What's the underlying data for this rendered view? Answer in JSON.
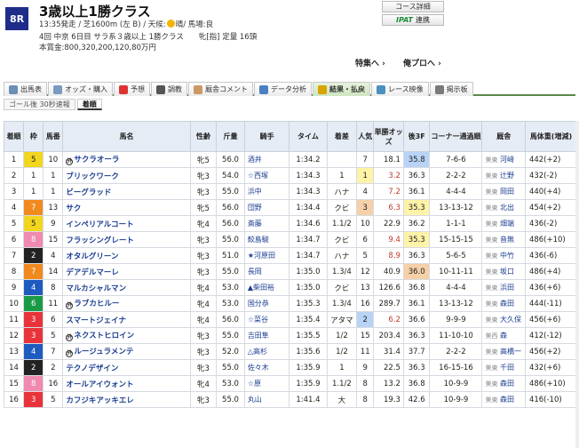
{
  "race": {
    "badge": "8R",
    "title": "3歳以上1勝クラス",
    "info1_a": "13:35発走 / 芝1600m (左 B) / 天候:",
    "weather": "晴",
    "info1_b": "/ 馬場:良",
    "info2": "4回 中京 6日目 サラ系３歳以上 1勝クラス　　牝[指] 定量 16頭",
    "info3": "本賞金:800,320,200,120,80万円"
  },
  "buttons": {
    "course": "コース詳細",
    "ipat": "IPAT",
    "ipat_sub": "連携"
  },
  "links": {
    "special": "特集へ",
    "pro": "俺プロへ"
  },
  "tabs": [
    {
      "label": "出馬表",
      "icon": "table-icon"
    },
    {
      "label": "オッズ・購入",
      "icon": "odds-icon"
    },
    {
      "label": "予想",
      "icon": "target-icon"
    },
    {
      "label": "調教",
      "icon": "timer-icon"
    },
    {
      "label": "厩舎コメント",
      "icon": "comment-icon"
    },
    {
      "label": "データ分析",
      "icon": "chart-icon"
    },
    {
      "label": "結果・払戻",
      "icon": "coin-icon"
    },
    {
      "label": "レース映像",
      "icon": "video-icon"
    },
    {
      "label": "掲示板",
      "icon": "board-icon"
    }
  ],
  "subtabs": [
    "ゴール後 30秒速報",
    "着順"
  ],
  "columns": [
    "着順",
    "枠",
    "馬番",
    "馬名",
    "性齢",
    "斤量",
    "騎手",
    "タイム",
    "着差",
    "人気",
    "単勝オッズ",
    "後3F",
    "コーナー通過順",
    "厩舎",
    "馬体重(増減)"
  ],
  "rows": [
    {
      "pos": "1",
      "gate": "5",
      "num": "10",
      "mark": "外",
      "name": "サクラオーラ",
      "sa": "牝5",
      "wgt": "56.0",
      "jockey": "酒井",
      "time": "1:34.2",
      "margin": "",
      "pop": "7",
      "odds": "18.1",
      "f3": "35.8",
      "corner": "7-6-6",
      "tr": "美東",
      "trainer": "河﨑",
      "bw": "442(+2)",
      "f3c": "m2"
    },
    {
      "pos": "2",
      "gate": "1",
      "num": "1",
      "mark": "",
      "name": "ブリックワーク",
      "sa": "牝3",
      "wgt": "54.0",
      "jockey": "☆西塚",
      "time": "1:34.3",
      "margin": "1",
      "pop": "1",
      "odds": "3.2",
      "f3": "36.3",
      "corner": "2-2-2",
      "tr": "美東",
      "trainer": "辻野",
      "bw": "432(-2)",
      "popc": "m1"
    },
    {
      "pos": "3",
      "gate": "1",
      "num": "1",
      "mark": "",
      "name": "ビーグラッド",
      "sa": "牝3",
      "wgt": "55.0",
      "jockey": "浜中",
      "time": "1:34.3",
      "margin": "ハナ",
      "pop": "4",
      "odds": "7.2",
      "f3": "36.1",
      "corner": "4-4-4",
      "tr": "美東",
      "trainer": "岡田",
      "bw": "440(+4)"
    },
    {
      "pos": "4",
      "gate": "7",
      "num": "13",
      "mark": "",
      "name": "サク",
      "sa": "牝5",
      "wgt": "56.0",
      "jockey": "団野",
      "time": "1:34.4",
      "margin": "クビ",
      "pop": "3",
      "odds": "6.3",
      "f3": "35.3",
      "corner": "13-13-12",
      "tr": "美東",
      "trainer": "北出",
      "bw": "454(+2)",
      "popc": "m3",
      "f3c": "m1"
    },
    {
      "pos": "5",
      "gate": "5",
      "num": "9",
      "mark": "",
      "name": "インペリアルコート",
      "sa": "牝4",
      "wgt": "56.0",
      "jockey": "斎藤",
      "time": "1:34.6",
      "margin": "1.1/2",
      "pop": "10",
      "odds": "22.9",
      "f3": "36.2",
      "corner": "1-1-1",
      "tr": "美東",
      "trainer": "畑端",
      "bw": "436(-2)"
    },
    {
      "pos": "6",
      "gate": "8",
      "num": "15",
      "mark": "",
      "name": "フラッシングレート",
      "sa": "牝3",
      "wgt": "55.0",
      "jockey": "鮫島駿",
      "time": "1:34.7",
      "margin": "クビ",
      "pop": "6",
      "odds": "9.4",
      "f3": "35.3",
      "corner": "15-15-15",
      "tr": "美東",
      "trainer": "音無",
      "bw": "486(+10)",
      "f3c": "m1"
    },
    {
      "pos": "7",
      "gate": "2",
      "num": "4",
      "mark": "",
      "name": "オタルグリーン",
      "sa": "牝3",
      "wgt": "51.0",
      "jockey": "★河原田",
      "time": "1:34.7",
      "margin": "ハナ",
      "pop": "5",
      "odds": "8.9",
      "f3": "36.3",
      "corner": "5-6-5",
      "tr": "美東",
      "trainer": "中竹",
      "bw": "436(-6)"
    },
    {
      "pos": "8",
      "gate": "7",
      "num": "14",
      "mark": "",
      "name": "デアデルマーレ",
      "sa": "牝3",
      "wgt": "55.0",
      "jockey": "長岡",
      "time": "1:35.0",
      "margin": "1.3/4",
      "pop": "12",
      "odds": "40.9",
      "f3": "36.0",
      "corner": "10-11-11",
      "tr": "美東",
      "trainer": "坂口",
      "bw": "486(+4)",
      "f3c": "m3"
    },
    {
      "pos": "9",
      "gate": "4",
      "num": "8",
      "mark": "",
      "name": "マルカシャルマン",
      "sa": "牝4",
      "wgt": "53.0",
      "jockey": "▲柴田裕",
      "time": "1:35.0",
      "margin": "クビ",
      "pop": "13",
      "odds": "126.6",
      "f3": "36.8",
      "corner": "4-4-4",
      "tr": "美東",
      "trainer": "浜田",
      "bw": "436(+6)"
    },
    {
      "pos": "10",
      "gate": "6",
      "num": "11",
      "mark": "外",
      "name": "ラブカヒルー",
      "sa": "牝4",
      "wgt": "53.0",
      "jockey": "国分恭",
      "time": "1:35.3",
      "margin": "1.3/4",
      "pop": "16",
      "odds": "289.7",
      "f3": "36.1",
      "corner": "13-13-12",
      "tr": "美東",
      "trainer": "森田",
      "bw": "444(-11)"
    },
    {
      "pos": "11",
      "gate": "3",
      "num": "6",
      "mark": "",
      "name": "スマートジェイナ",
      "sa": "牝4",
      "wgt": "56.0",
      "jockey": "☆菜谷",
      "time": "1:35.4",
      "margin": "アタマ",
      "pop": "2",
      "odds": "6.2",
      "f3": "36.6",
      "corner": "9-9-9",
      "tr": "美東",
      "trainer": "大久保",
      "bw": "456(+6)",
      "popc": "m2"
    },
    {
      "pos": "12",
      "gate": "3",
      "num": "5",
      "mark": "外",
      "name": "ネクストヒロイン",
      "sa": "牝3",
      "wgt": "55.0",
      "jockey": "吉田隼",
      "time": "1:35.5",
      "margin": "1/2",
      "pop": "15",
      "odds": "203.4",
      "f3": "36.3",
      "corner": "11-10-10",
      "tr": "美西",
      "trainer": "森",
      "bw": "412(-12)"
    },
    {
      "pos": "13",
      "gate": "4",
      "num": "7",
      "mark": "外",
      "name": "ルージュラメンテ",
      "sa": "牝3",
      "wgt": "52.0",
      "jockey": "△高杉",
      "time": "1:35.6",
      "margin": "1/2",
      "pop": "11",
      "odds": "31.4",
      "f3": "37.7",
      "corner": "2-2-2",
      "tr": "美東",
      "trainer": "高橋一",
      "bw": "456(+2)"
    },
    {
      "pos": "14",
      "gate": "2",
      "num": "2",
      "mark": "",
      "name": "テクノデザイン",
      "sa": "牝3",
      "wgt": "55.0",
      "jockey": "佐々木",
      "time": "1:35.9",
      "margin": "1",
      "pop": "9",
      "odds": "22.5",
      "f3": "36.3",
      "corner": "16-15-16",
      "tr": "美東",
      "trainer": "千田",
      "bw": "432(+6)"
    },
    {
      "pos": "15",
      "gate": "8",
      "num": "16",
      "mark": "",
      "name": "オールアイウォント",
      "sa": "牝4",
      "wgt": "53.0",
      "jockey": "☆原",
      "time": "1:35.9",
      "margin": "1.1/2",
      "pop": "8",
      "odds": "13.2",
      "f3": "36.8",
      "corner": "10-9-9",
      "tr": "美東",
      "trainer": "森田",
      "bw": "486(+10)"
    },
    {
      "pos": "16",
      "gate": "3",
      "num": "5",
      "mark": "",
      "name": "カフジキアッキエレ",
      "sa": "牝3",
      "wgt": "55.0",
      "jockey": "丸山",
      "time": "1:41.4",
      "margin": "大",
      "pop": "8",
      "odds": "19.3",
      "f3": "42.6",
      "corner": "10-9-9",
      "tr": "美東",
      "trainer": "森田",
      "bw": "416(-10)"
    }
  ],
  "colors": {
    "tab_active": "#cfe5c0",
    "header_bg": "#e6ecf5",
    "link": "#1a3d8f",
    "fav_odds": "#c0392b"
  }
}
